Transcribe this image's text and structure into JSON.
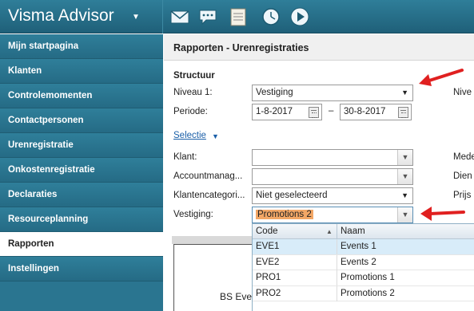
{
  "app": {
    "title": "Visma Advisor"
  },
  "toolbar": {
    "icons": [
      "mail-icon",
      "chat-icon",
      "notes-icon",
      "clock-icon",
      "play-icon"
    ]
  },
  "sidebar": {
    "items": [
      {
        "label": "Mijn startpagina"
      },
      {
        "label": "Klanten"
      },
      {
        "label": "Controlemomenten"
      },
      {
        "label": "Contactpersonen"
      },
      {
        "label": "Urenregistratie"
      },
      {
        "label": "Onkostenregistratie"
      },
      {
        "label": "Declaraties"
      },
      {
        "label": "Resourceplanning"
      },
      {
        "label": "Rapporten",
        "active": true
      },
      {
        "label": "Instellingen"
      }
    ]
  },
  "page": {
    "title": "Rapporten - Urenregistraties",
    "structuur_label": "Structuur",
    "niveau1": {
      "label": "Niveau 1:",
      "value": "Vestiging"
    },
    "periode": {
      "label": "Periode:",
      "from": "1-8-2017",
      "separator": "–",
      "to": "30-8-2017"
    },
    "selectie_link": "Selectie",
    "klant": {
      "label": "Klant:",
      "value": ""
    },
    "accountmanager": {
      "label": "Accountmanag...",
      "value": ""
    },
    "klantencategorie": {
      "label": "Klantencategori...",
      "value": "Niet geselecteerd"
    },
    "vestiging": {
      "label": "Vestiging:",
      "value": "Promotions 2"
    },
    "right_labels": [
      "Nive",
      "Mede",
      "Dien",
      "Prijs"
    ],
    "report_preview_text": "BS Eve"
  },
  "dropdown": {
    "columns": [
      "Code",
      "Naam"
    ],
    "rows": [
      {
        "code": "EVE1",
        "naam": "Events 1",
        "selected": true
      },
      {
        "code": "EVE2",
        "naam": "Events 2"
      },
      {
        "code": "PRO1",
        "naam": "Promotions 1"
      },
      {
        "code": "PRO2",
        "naam": "Promotions 2"
      }
    ]
  },
  "colors": {
    "header": "#2a7590",
    "highlight": "#f3a766",
    "annotation_arrow": "#e02020",
    "selected_row": "#d8ecf9"
  }
}
